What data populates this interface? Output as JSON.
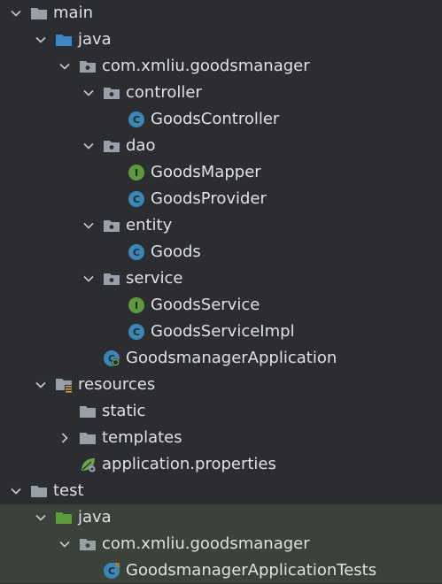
{
  "colors": {
    "background": "#2b2d30",
    "test_background": "#3b4239",
    "text": "#dfe1e5",
    "folder": "#9aa0a8",
    "java_folder": "#3d88c4",
    "test_folder": "#5a9e3a",
    "class_icon": "#3b87b5",
    "interface_icon": "#5c9a3b"
  },
  "tree": [
    {
      "label": "main",
      "icon": "folder-icon",
      "expanded": true
    },
    {
      "label": "java",
      "icon": "source-folder-icon",
      "expanded": true
    },
    {
      "label": "com.xmliu.goodsmanager",
      "icon": "package-icon",
      "expanded": true
    },
    {
      "label": "controller",
      "icon": "package-icon",
      "expanded": true
    },
    {
      "label": "GoodsController",
      "icon": "class-icon"
    },
    {
      "label": "dao",
      "icon": "package-icon",
      "expanded": true
    },
    {
      "label": "GoodsMapper",
      "icon": "interface-icon"
    },
    {
      "label": "GoodsProvider",
      "icon": "class-icon"
    },
    {
      "label": "entity",
      "icon": "package-icon",
      "expanded": true
    },
    {
      "label": "Goods",
      "icon": "class-icon"
    },
    {
      "label": "service",
      "icon": "package-icon",
      "expanded": true
    },
    {
      "label": "GoodsService",
      "icon": "interface-icon"
    },
    {
      "label": "GoodsServiceImpl",
      "icon": "class-icon"
    },
    {
      "label": "GoodsmanagerApplication",
      "icon": "spring-boot-class-icon"
    },
    {
      "label": "resources",
      "icon": "resources-folder-icon",
      "expanded": true
    },
    {
      "label": "static",
      "icon": "folder-icon"
    },
    {
      "label": "templates",
      "icon": "folder-icon",
      "expanded": false
    },
    {
      "label": "application.properties",
      "icon": "spring-properties-icon"
    },
    {
      "label": "test",
      "icon": "folder-icon",
      "expanded": true
    },
    {
      "label": "java",
      "icon": "test-source-folder-icon",
      "expanded": true
    },
    {
      "label": "com.xmliu.goodsmanager",
      "icon": "package-icon",
      "expanded": true
    },
    {
      "label": "GoodsmanagerApplicationTests",
      "icon": "test-class-icon"
    }
  ]
}
